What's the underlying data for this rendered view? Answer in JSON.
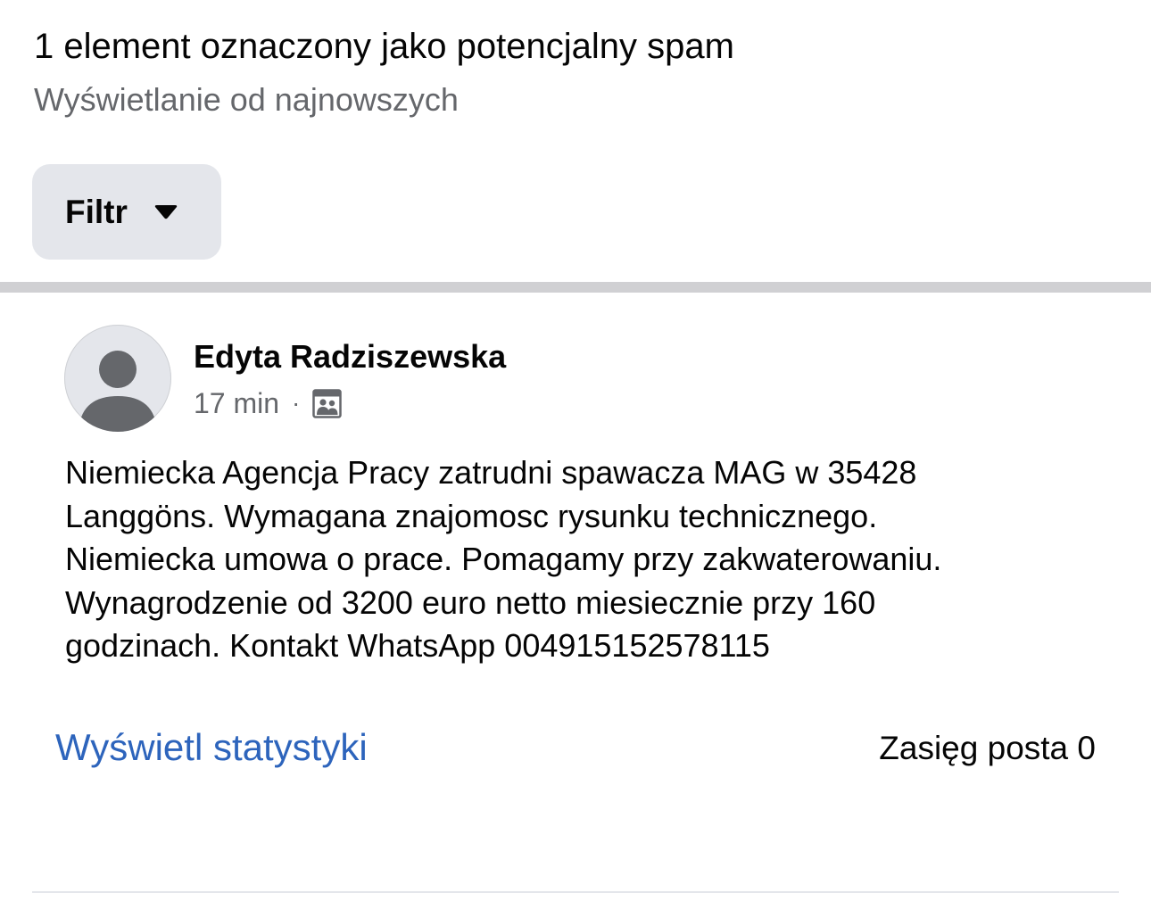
{
  "header": {
    "title": "1 element oznaczony jako potencjalny spam",
    "subtitle": "Wyświetlanie od najnowszych"
  },
  "filter": {
    "label": "Filtr",
    "icon": "caret-down-icon"
  },
  "post": {
    "author": "Edyta Radziszewska",
    "avatar_icon": "default-avatar-icon",
    "time": "17 min",
    "separator": "·",
    "audience_icon": "group-audience-icon",
    "body": "Niemiecka Agencja Pracy zatrudni spawacza MAG w 35428\nLanggöns. Wymagana znajomosc rysunku technicznego.\nNiemiecka umowa o prace. Pomagamy przy zakwaterowaniu.\nWynagrodzenie od 3200 euro netto miesiecznie przy 160\ngodzinach. Kontakt WhatsApp 004915152578115",
    "stats_link": "Wyświetl statystyki",
    "reach": "Zasięg posta 0"
  },
  "colors": {
    "link": "#2d64bc",
    "secondary_text": "#65676b",
    "button_bg": "#e4e6eb",
    "divider": "#d0d0d3"
  }
}
